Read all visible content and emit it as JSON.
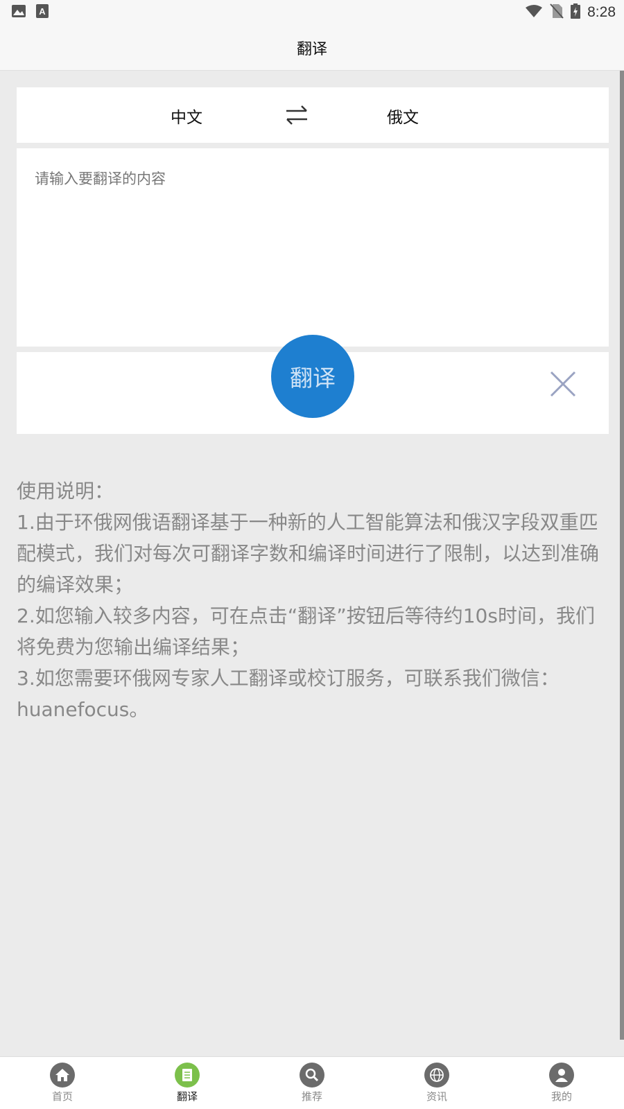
{
  "status_bar": {
    "time": "8:28",
    "icons": [
      "image-icon",
      "font-icon",
      "wifi-icon",
      "no-sim-icon",
      "battery-charging-icon"
    ]
  },
  "app_bar": {
    "title": "翻译"
  },
  "language_bar": {
    "source": "中文",
    "target": "俄文",
    "swap_icon": "swap-arrows-icon"
  },
  "input": {
    "placeholder": "请输入要翻译的内容",
    "value": ""
  },
  "actions": {
    "translate_label": "翻译",
    "clear_icon": "close-icon"
  },
  "instructions": {
    "heading": "使用说明：",
    "items": [
      "1.由于环俄网俄语翻译基于一种新的人工智能算法和俄汉字段双重匹配模式，我们对每次可翻译字数和编译时间进行了限制，以达到准确的编译效果；",
      "2.如您输入较多内容，可在点击“翻译”按钮后等待约10s时间，我们将免费为您输出编译结果；",
      "3.如您需要环俄网专家人工翻译或校订服务，可联系我们微信：huanefocus。"
    ]
  },
  "bottom_nav": {
    "items": [
      {
        "label": "首页",
        "icon": "home-icon"
      },
      {
        "label": "翻译",
        "icon": "document-icon",
        "active": true
      },
      {
        "label": "推荐",
        "icon": "search-icon"
      },
      {
        "label": "资讯",
        "icon": "globe-icon"
      },
      {
        "label": "我的",
        "icon": "user-icon"
      }
    ]
  },
  "colors": {
    "accent": "#1e7fd0",
    "active_tab": "#7cc04b",
    "inactive_tab": "#6b6b6b",
    "background": "#ebebeb"
  }
}
